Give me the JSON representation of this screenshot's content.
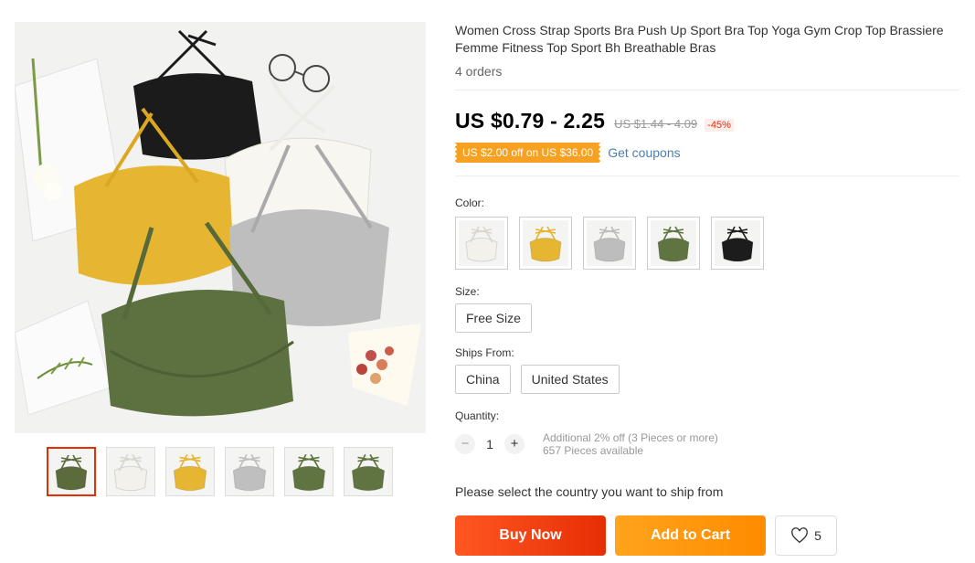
{
  "product": {
    "title": "Women Cross Strap Sports Bra Push Up Sport Bra Top Yoga Gym Crop Top Brassiere Femme Fitness Top Sport Bh Breathable Bras",
    "orders": "4 orders",
    "price": "US $0.79 - 2.25",
    "original_price": "US $1.44 - 4.09",
    "discount": "-45%",
    "coupon": "US $2.00 off on US $36.00",
    "get_coupons": "Get coupons"
  },
  "gallery": {
    "thumbnails": [
      {
        "name": "thumb-all-colors",
        "color": "#5b6b3c"
      },
      {
        "name": "thumb-white",
        "color": "#f2f1ec"
      },
      {
        "name": "thumb-yellow",
        "color": "#e6b531"
      },
      {
        "name": "thumb-gray",
        "color": "#bfbfbf"
      },
      {
        "name": "thumb-green",
        "color": "#5f7440"
      },
      {
        "name": "thumb-green-back",
        "color": "#5f7440"
      }
    ]
  },
  "color": {
    "label": "Color:",
    "swatches": [
      {
        "name": "white",
        "color": "#f2f1ec"
      },
      {
        "name": "yellow",
        "color": "#e6b531"
      },
      {
        "name": "gray",
        "color": "#bdbdbd"
      },
      {
        "name": "green",
        "color": "#5f7440"
      },
      {
        "name": "black",
        "color": "#1c1c1c"
      }
    ]
  },
  "size": {
    "label": "Size:",
    "options": [
      "Free Size"
    ]
  },
  "ships_from": {
    "label": "Ships From:",
    "options": [
      "China",
      "United States"
    ]
  },
  "quantity": {
    "label": "Quantity:",
    "minus": "−",
    "plus": "+",
    "value": "1",
    "additional": "Additional 2% off (3 Pieces or more)",
    "available": "657 Pieces available"
  },
  "ship_note": "Please select the country you want to ship from",
  "actions": {
    "buy_now": "Buy Now",
    "add_to_cart": "Add to Cart",
    "wishlist_count": "5"
  },
  "colors": {
    "accent_red": "#e62e04",
    "accent_orange": "#ff8b00",
    "coupon": "#f7a123",
    "link": "#4a7fb5"
  }
}
